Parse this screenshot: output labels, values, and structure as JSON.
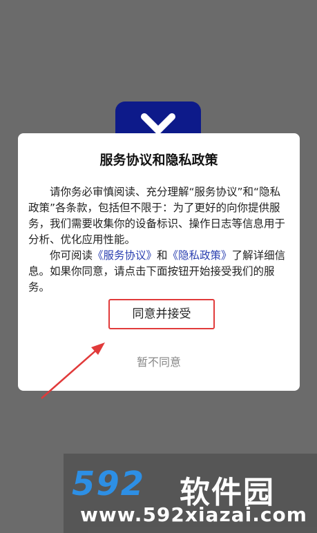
{
  "dialog": {
    "title": "服务协议和隐私政策",
    "para1": "请你务必审慎阅读、充分理解“服务协议”和“隐私政策”各条款，包括但不限于：为了更好的向你提供服务，我们需要收集你的设备标识、操作日志等信息用于分析、优化应用性能。",
    "para2_prefix": "你可阅读",
    "link_service": "《服务协议》",
    "para2_and": "和",
    "link_privacy": "《隐私政策》",
    "para2_suffix": "了解详细信息。如果你同意，请点击下面按钮开始接受我们的服务。",
    "accept_label": "同意并接受",
    "decline_label": "暂不同意"
  },
  "watermark": {
    "logo_number": "592",
    "logo_name": "软件园",
    "url": "www.592xiazai.com"
  },
  "colors": {
    "overlay": "#6b6b6b",
    "app_icon": "#0d1a8a",
    "link": "#2a3fb0",
    "highlight": "#e13a3a"
  }
}
